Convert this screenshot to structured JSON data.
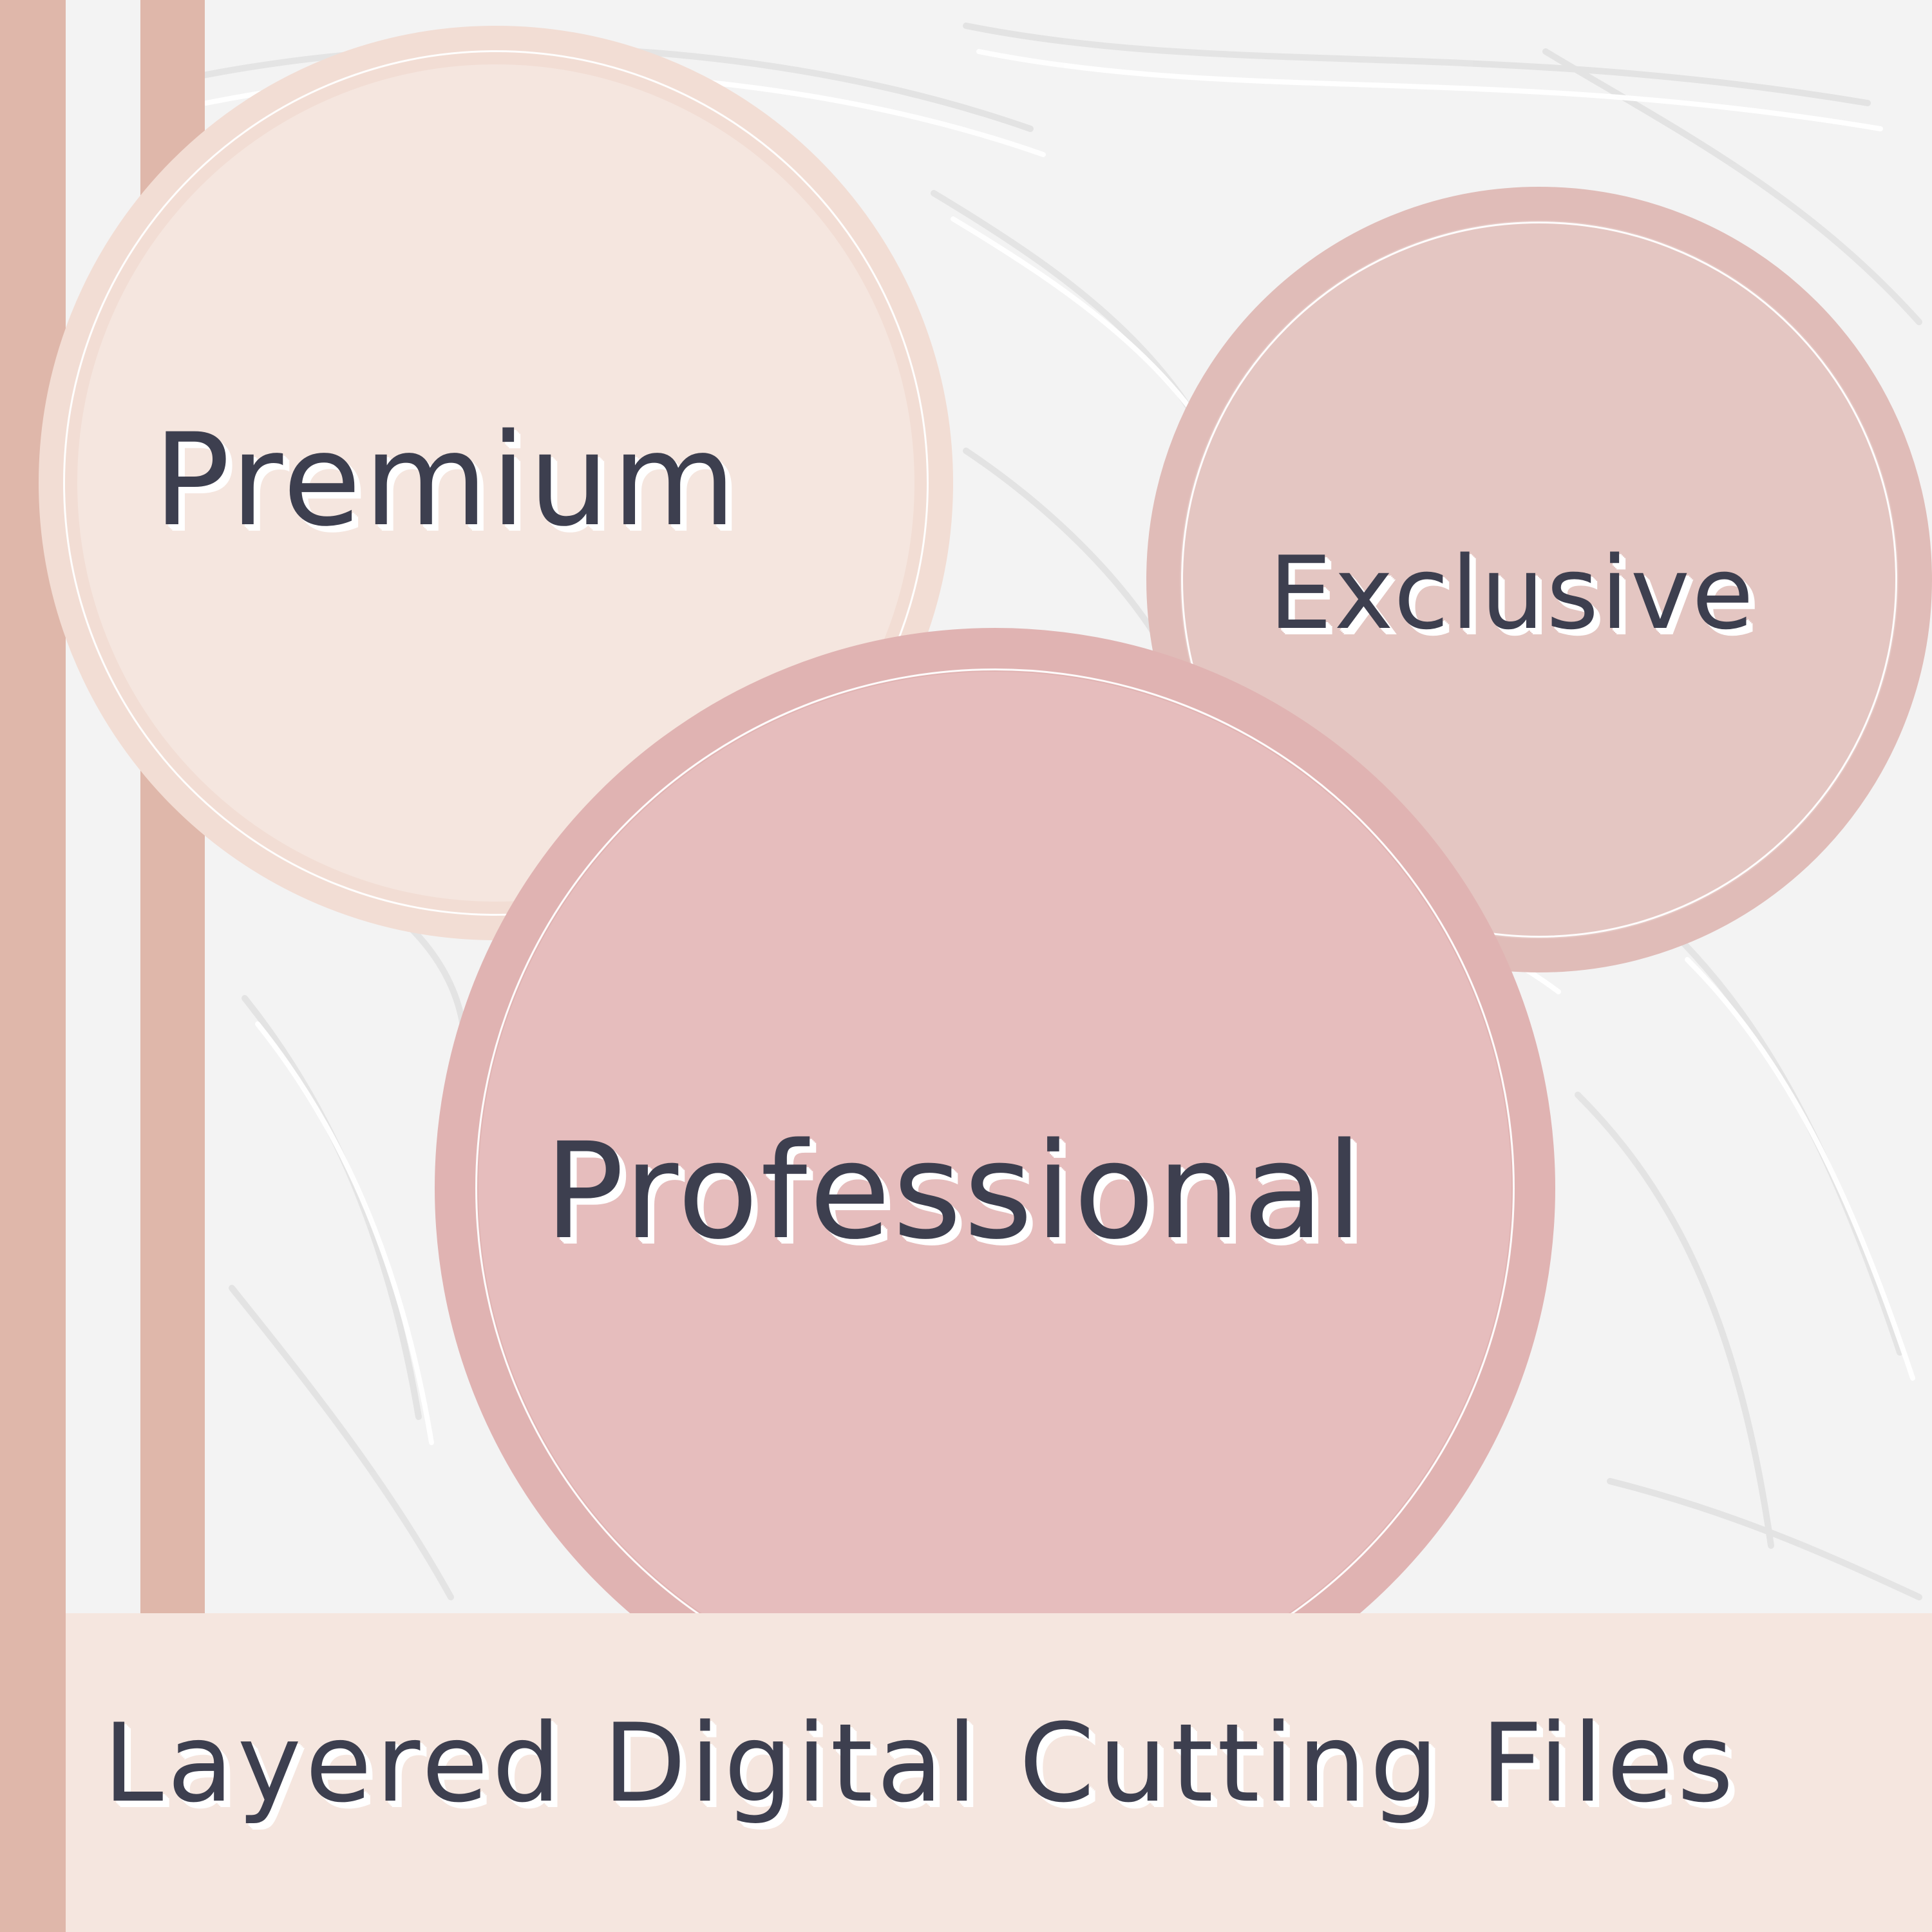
{
  "colors": {
    "background": "#f3f3f3",
    "stripe": "#dfb7aa",
    "premium_circle": "#f5e6df",
    "premium_border": "#f2ddd4",
    "exclusive_circle": "#e4c6c2",
    "exclusive_border": "#e0bcb8",
    "professional_circle": "#e6bdbd",
    "professional_border": "#e0b3b2",
    "footer_band": "#f5e6df",
    "text": "#3d3f4f",
    "text_shadow": "#ffffff"
  },
  "badges": {
    "premium": "Premium",
    "exclusive": "Exclusive",
    "professional": "Professional"
  },
  "footer": {
    "title": "Layered Digital Cutting Files"
  }
}
